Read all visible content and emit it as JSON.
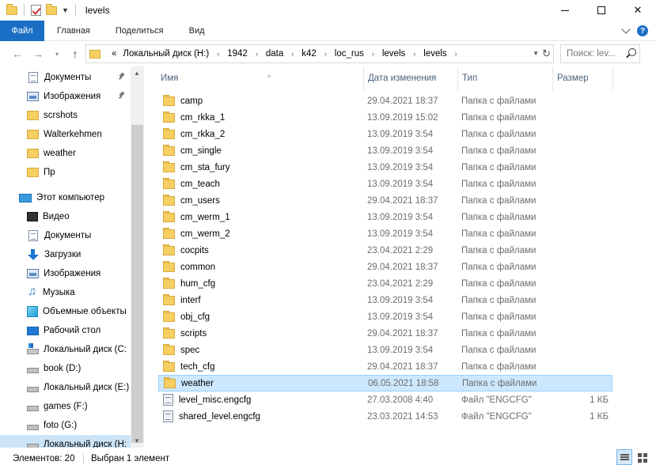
{
  "window": {
    "title": "levels"
  },
  "ribbon": {
    "file_tab": "Файл",
    "tabs": [
      "Главная",
      "Поделиться",
      "Вид"
    ]
  },
  "address": {
    "prefix": "«",
    "crumbs": [
      "Локальный диск (H:)",
      "1942",
      "data",
      "k42",
      "loc_rus",
      "levels",
      "levels"
    ]
  },
  "search": {
    "placeholder": "Поиск: lev..."
  },
  "nav": {
    "items": [
      {
        "label": "Документы",
        "icon": "documents-icon",
        "pinned": true
      },
      {
        "label": "Изображения",
        "icon": "pictures-icon",
        "pinned": true
      },
      {
        "label": "scrshots",
        "icon": "folder-icon"
      },
      {
        "label": "Walterkehmen",
        "icon": "folder-icon"
      },
      {
        "label": "weather",
        "icon": "folder-icon"
      },
      {
        "label": "Пр",
        "icon": "folder-icon"
      },
      {
        "label": "Этот компьютер",
        "icon": "computer-icon"
      },
      {
        "label": "Видео",
        "icon": "video-icon"
      },
      {
        "label": "Документы",
        "icon": "documents-icon"
      },
      {
        "label": "Загрузки",
        "icon": "downloads-icon"
      },
      {
        "label": "Изображения",
        "icon": "pictures-icon"
      },
      {
        "label": "Музыка",
        "icon": "music-icon"
      },
      {
        "label": "Объемные объекты",
        "icon": "3d-objects-icon"
      },
      {
        "label": "Рабочий стол",
        "icon": "desktop-icon"
      },
      {
        "label": "Локальный диск (C:",
        "icon": "drive-icon"
      },
      {
        "label": "book (D:)",
        "icon": "drive-icon"
      },
      {
        "label": "Локальный диск (E:)",
        "icon": "drive-icon"
      },
      {
        "label": "games (F:)",
        "icon": "drive-icon"
      },
      {
        "label": "foto (G:)",
        "icon": "drive-icon"
      },
      {
        "label": "Локальный диск (H:",
        "icon": "drive-icon",
        "selected": true
      }
    ]
  },
  "columns": {
    "name": "Имя",
    "date": "Дата изменения",
    "type": "Тип",
    "size": "Размер"
  },
  "files": [
    {
      "name": "camp",
      "date": "29.04.2021 18:37",
      "type": "Папка с файлами",
      "size": "",
      "kind": "folder"
    },
    {
      "name": "cm_rkka_1",
      "date": "13.09.2019 15:02",
      "type": "Папка с файлами",
      "size": "",
      "kind": "folder"
    },
    {
      "name": "cm_rkka_2",
      "date": "13.09.2019 3:54",
      "type": "Папка с файлами",
      "size": "",
      "kind": "folder"
    },
    {
      "name": "cm_single",
      "date": "13.09.2019 3:54",
      "type": "Папка с файлами",
      "size": "",
      "kind": "folder"
    },
    {
      "name": "cm_sta_fury",
      "date": "13.09.2019 3:54",
      "type": "Папка с файлами",
      "size": "",
      "kind": "folder"
    },
    {
      "name": "cm_teach",
      "date": "13.09.2019 3:54",
      "type": "Папка с файлами",
      "size": "",
      "kind": "folder"
    },
    {
      "name": "cm_users",
      "date": "29.04.2021 18:37",
      "type": "Папка с файлами",
      "size": "",
      "kind": "folder"
    },
    {
      "name": "cm_werm_1",
      "date": "13.09.2019 3:54",
      "type": "Папка с файлами",
      "size": "",
      "kind": "folder"
    },
    {
      "name": "cm_werm_2",
      "date": "13.09.2019 3:54",
      "type": "Папка с файлами",
      "size": "",
      "kind": "folder"
    },
    {
      "name": "cocpits",
      "date": "23.04.2021 2:29",
      "type": "Папка с файлами",
      "size": "",
      "kind": "folder"
    },
    {
      "name": "common",
      "date": "29.04.2021 18:37",
      "type": "Папка с файлами",
      "size": "",
      "kind": "folder"
    },
    {
      "name": "hum_cfg",
      "date": "23.04.2021 2:29",
      "type": "Папка с файлами",
      "size": "",
      "kind": "folder"
    },
    {
      "name": "interf",
      "date": "13.09.2019 3:54",
      "type": "Папка с файлами",
      "size": "",
      "kind": "folder"
    },
    {
      "name": "obj_cfg",
      "date": "13.09.2019 3:54",
      "type": "Папка с файлами",
      "size": "",
      "kind": "folder"
    },
    {
      "name": "scripts",
      "date": "29.04.2021 18:37",
      "type": "Папка с файлами",
      "size": "",
      "kind": "folder"
    },
    {
      "name": "spec",
      "date": "13.09.2019 3:54",
      "type": "Папка с файлами",
      "size": "",
      "kind": "folder"
    },
    {
      "name": "tech_cfg",
      "date": "29.04.2021 18:37",
      "type": "Папка с файлами",
      "size": "",
      "kind": "folder"
    },
    {
      "name": "weather",
      "date": "06.05.2021 18:58",
      "type": "Папка с файлами",
      "size": "",
      "kind": "folder",
      "selected": true
    },
    {
      "name": "level_misc.engcfg",
      "date": "27.03.2008 4:40",
      "type": "Файл \"ENGCFG\"",
      "size": "1 КБ",
      "kind": "file"
    },
    {
      "name": "shared_level.engcfg",
      "date": "23.03.2021 14:53",
      "type": "Файл \"ENGCFG\"",
      "size": "1 КБ",
      "kind": "file"
    }
  ],
  "status": {
    "count": "Элементов: 20",
    "selection": "Выбран 1 элемент"
  },
  "colors": {
    "accent": "#1a6fc4",
    "selection": "#cce8ff",
    "folder": "#f6cf62"
  }
}
